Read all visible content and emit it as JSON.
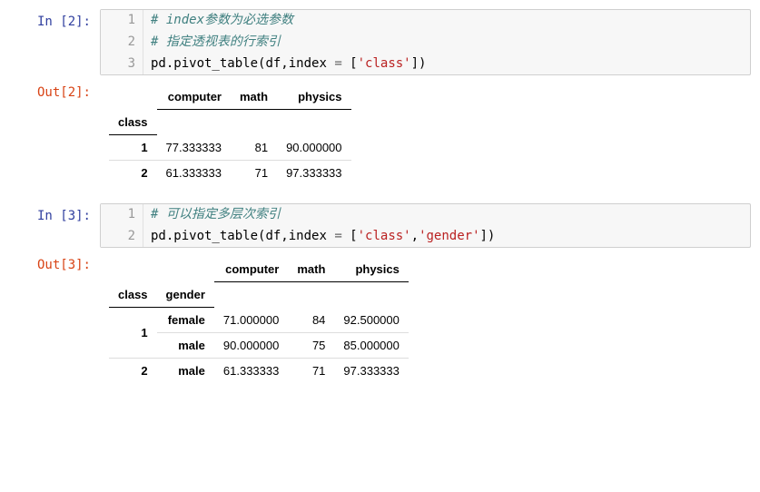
{
  "cells": {
    "in2": {
      "prompt": "In  [2]:",
      "lines": {
        "g1": "1",
        "g2": "2",
        "g3": "3",
        "c1": "# index参数为必选参数",
        "c2": "# 指定透视表的行索引",
        "c3_part1": "pd.pivot_table",
        "c3_paren_open": "(",
        "c3_arg1": "df,index ",
        "c3_eq": "= ",
        "c3_bracket_open": "[",
        "c3_str": "'class'",
        "c3_bracket_close": "])"
      }
    },
    "out2": {
      "prompt": "Out[2]:",
      "headers": {
        "c0": "",
        "c1": "computer",
        "c2": "math",
        "c3": "physics"
      },
      "index_name": "class",
      "rows": {
        "r0": {
          "idx": "1",
          "computer": "77.333333",
          "math": "81",
          "physics": "90.000000"
        },
        "r1": {
          "idx": "2",
          "computer": "61.333333",
          "math": "71",
          "physics": "97.333333"
        }
      }
    },
    "in3": {
      "prompt": "In  [3]:",
      "lines": {
        "g1": "1",
        "g2": "2",
        "c1": "# 可以指定多层次索引",
        "c2_part1": "pd.pivot_table",
        "c2_paren_open": "(",
        "c2_arg1": "df,index ",
        "c2_eq": "= ",
        "c2_bracket_open": "[",
        "c2_str1": "'class'",
        "c2_comma": ",",
        "c2_str2": "'gender'",
        "c2_bracket_close": "])"
      }
    },
    "out3": {
      "prompt": "Out[3]:",
      "headers": {
        "c0": "",
        "c1": "",
        "c2": "computer",
        "c3": "math",
        "c4": "physics"
      },
      "index_names": {
        "i0": "class",
        "i1": "gender"
      },
      "rows": {
        "r0": {
          "class": "1",
          "gender": "female",
          "computer": "71.000000",
          "math": "84",
          "physics": "92.500000"
        },
        "r1": {
          "class": "",
          "gender": "male",
          "computer": "90.000000",
          "math": "75",
          "physics": "85.000000"
        },
        "r2": {
          "class": "2",
          "gender": "male",
          "computer": "61.333333",
          "math": "71",
          "physics": "97.333333"
        }
      }
    }
  },
  "chart_data": [
    {
      "type": "table",
      "title": "pivot_table by class",
      "index_name": "class",
      "columns": [
        "computer",
        "math",
        "physics"
      ],
      "rows": [
        {
          "class": 1,
          "computer": 77.333333,
          "math": 81,
          "physics": 90.0
        },
        {
          "class": 2,
          "computer": 61.333333,
          "math": 71,
          "physics": 97.333333
        }
      ]
    },
    {
      "type": "table",
      "title": "pivot_table by class, gender",
      "index_names": [
        "class",
        "gender"
      ],
      "columns": [
        "computer",
        "math",
        "physics"
      ],
      "rows": [
        {
          "class": 1,
          "gender": "female",
          "computer": 71.0,
          "math": 84,
          "physics": 92.5
        },
        {
          "class": 1,
          "gender": "male",
          "computer": 90.0,
          "math": 75,
          "physics": 85.0
        },
        {
          "class": 2,
          "gender": "male",
          "computer": 61.333333,
          "math": 71,
          "physics": 97.333333
        }
      ]
    }
  ]
}
